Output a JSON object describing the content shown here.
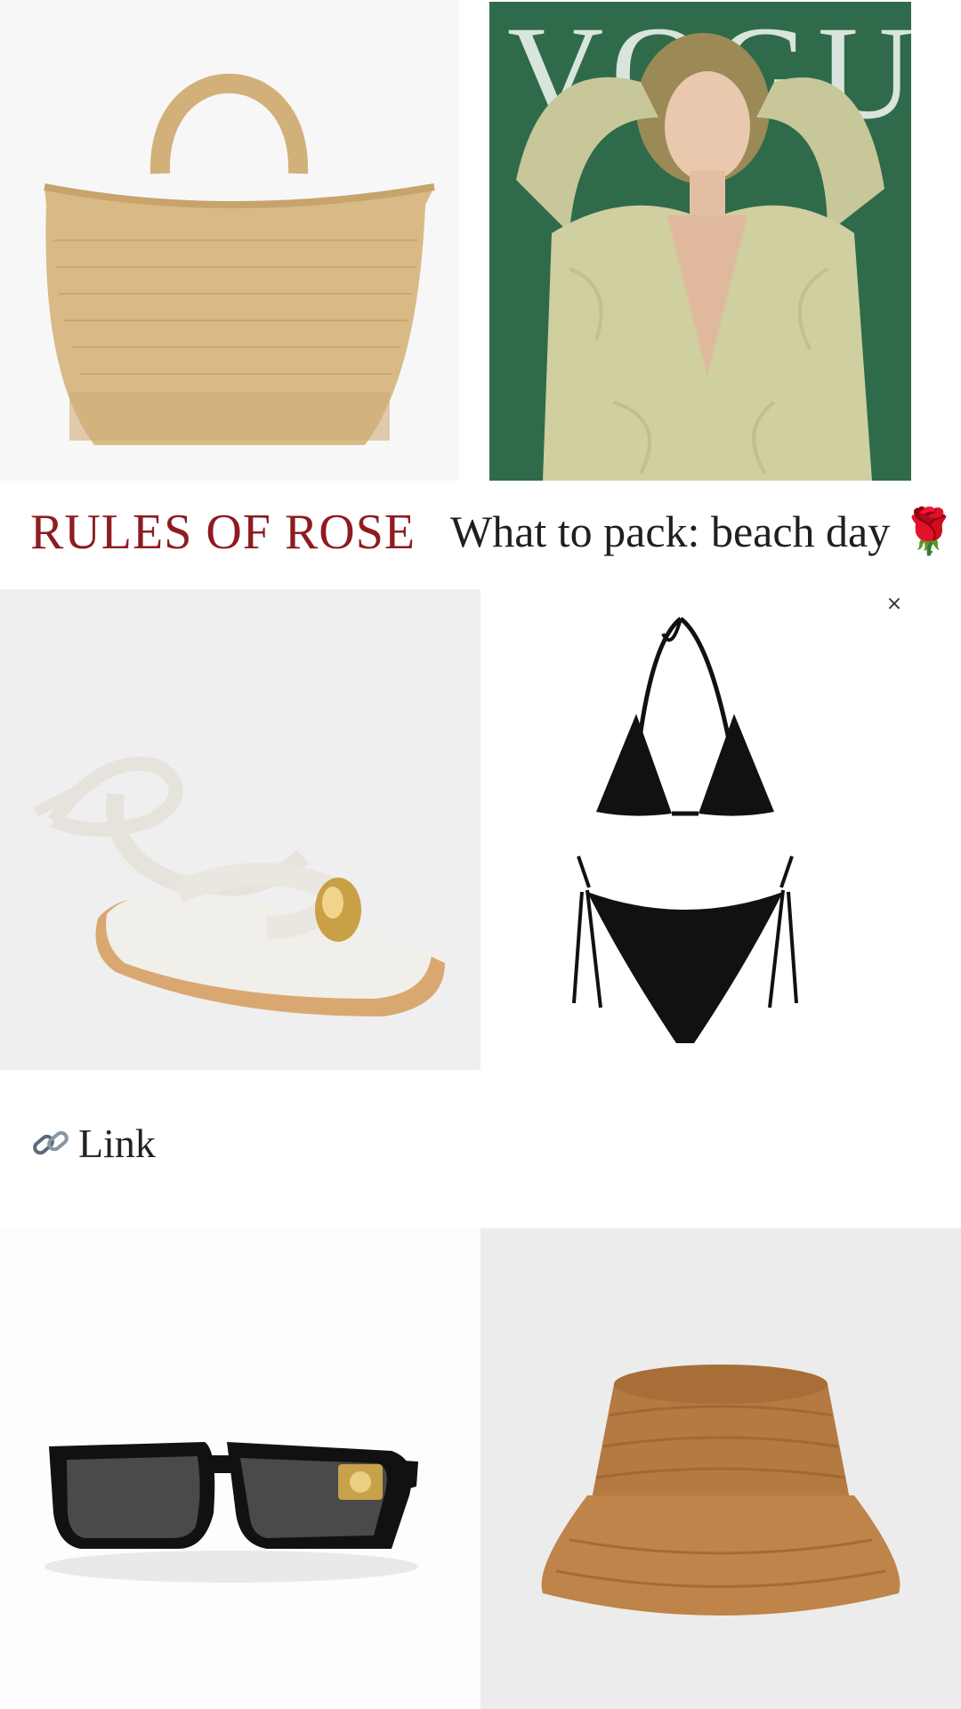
{
  "brand": {
    "title": "RULES OF ROSE"
  },
  "headline": {
    "text": "What to pack: beach day",
    "emoji": "🌹"
  },
  "link": {
    "icon": "link-icon",
    "label": "Link"
  },
  "close": {
    "label": "×"
  },
  "magazine": {
    "masthead": "VOGUE"
  },
  "colors": {
    "brand": "#8e1c1f",
    "vogue_bg": "#2f6b4b",
    "straw": "#d6b37e",
    "hat": "#b47a42"
  },
  "products": [
    {
      "name": "straw tote bag"
    },
    {
      "name": "Vogue magazine cover"
    },
    {
      "name": "white wrap sandals"
    },
    {
      "name": "black bikini"
    },
    {
      "name": "black sunglasses"
    },
    {
      "name": "straw bucket hat"
    }
  ]
}
